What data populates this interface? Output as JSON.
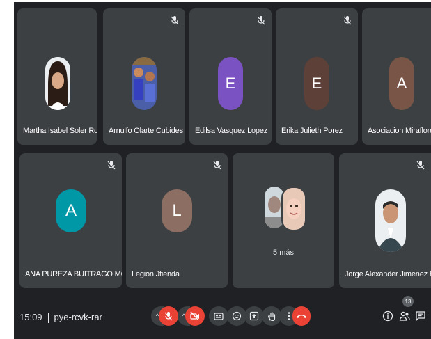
{
  "participants_row1": [
    {
      "name": "Martha Isabel Soler Rojas",
      "avatar": "photo",
      "muted": false
    },
    {
      "name": "Arnulfo Olarte Cubides",
      "avatar": "photo",
      "muted": true
    },
    {
      "name": "Edilsa Vasquez Lopez",
      "avatar": "letter",
      "initial": "E",
      "color": "#7b52c1",
      "muted": true
    },
    {
      "name": "Erika Julieth Porez",
      "avatar": "letter",
      "initial": "E",
      "color": "#5d4037",
      "muted": true
    },
    {
      "name": "Asociacion Miraflores De ag",
      "avatar": "letter",
      "initial": "A",
      "color": "#795548",
      "muted": false
    }
  ],
  "participants_row2": [
    {
      "name": "ANA PUREZA BUITRAGO MORALES",
      "avatar": "letter",
      "initial": "A",
      "color": "#0097a7",
      "muted": true
    },
    {
      "name": "Legion Jtienda",
      "avatar": "letter",
      "initial": "L",
      "color": "#8d6e63",
      "muted": true
    },
    {
      "name": "",
      "more_label": "5 más",
      "avatar": "group"
    },
    {
      "name": "Jorge Alexander Jimenez Bernal",
      "avatar": "photo",
      "muted": true
    }
  ],
  "meeting": {
    "time": "15:09",
    "code": "pye-rcvk-rar"
  },
  "controls": {
    "caret": "^",
    "icons": [
      "mic-off-icon",
      "camera-off-icon",
      "captions-icon",
      "emoji-icon",
      "present-icon",
      "raise-hand-icon",
      "more-options-icon",
      "end-call-icon"
    ]
  },
  "right_panel": {
    "people_count": "13",
    "icons": [
      "info-icon",
      "people-icon",
      "chat-icon"
    ]
  },
  "colors": {
    "background": "#202124",
    "tile": "#3c4043",
    "danger": "#ea4335"
  }
}
